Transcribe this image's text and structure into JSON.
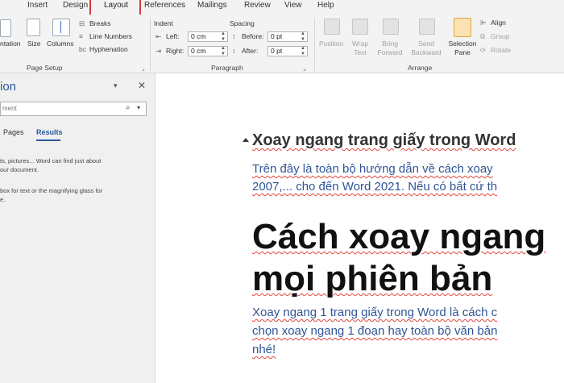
{
  "tabs": [
    "Insert",
    "Design",
    "Layout",
    "References",
    "Mailings",
    "Review",
    "View",
    "Help"
  ],
  "active_tab": "Layout",
  "ribbon": {
    "page_setup": {
      "orientation_label": "ntation",
      "size_label": "Size",
      "columns_label": "Columns",
      "breaks_label": "Breaks",
      "line_numbers_label": "Line Numbers",
      "hyphenation_label": "Hyphenation",
      "group_label": "Page Setup"
    },
    "paragraph": {
      "indent_label": "Indent",
      "left_label": "Left:",
      "right_label": "Right:",
      "left_value": "0 cm",
      "right_value": "0 cm",
      "spacing_label": "Spacing",
      "before_label": "Before:",
      "after_label": "After:",
      "before_value": "0 pt",
      "after_value": "0 pt",
      "group_label": "Paragraph"
    },
    "arrange": {
      "position_label": "Position",
      "wrap_text_label": "Wrap Text",
      "bring_forward_label": "Bring Forward",
      "send_backward_label": "Send Backward",
      "selection_pane_label": "Selection Pane",
      "align_label": "Align",
      "group_btn_label": "Group",
      "rotate_label": "Rotate",
      "group_label": "Arrange"
    }
  },
  "nav_pane": {
    "title": "ion",
    "search_placeholder": "ment",
    "tabs": [
      "Pages",
      "Results"
    ],
    "active_tab": "Results",
    "help_text_1a": "ts, pictures... Word can find just about",
    "help_text_1b": "our document.",
    "help_text_2a": " box for text or the magnifying glass for",
    "help_text_2b": "e."
  },
  "document": {
    "heading2": "Xoay ngang trang giấy trong Word",
    "para1_line1": "Trên đây là toàn bộ hướng dẫn về cách xoay",
    "para1_line2": "2007,... cho đến Word 2021. Nếu có bất cứ th",
    "heading1_line1": "Cách xoay ngang",
    "heading1_line2": "mọi phiên bản",
    "para2_line1": "Xoay ngang 1 trang giấy trong Word là cách c",
    "para2_line2": "chọn xoay ngang 1 đoạn hay toàn bộ văn bản",
    "para2_line3": "nhé!"
  },
  "colors": {
    "highlight_box": "#d33a3a",
    "word_blue": "#2b579a",
    "body_text_blue": "#2f5597",
    "spell_underline": "#e0473f"
  }
}
